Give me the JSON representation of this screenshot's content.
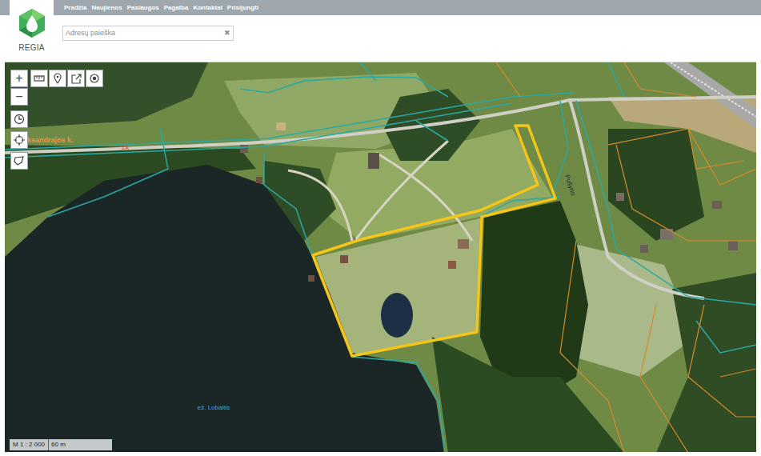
{
  "logo": {
    "label": "REGIA"
  },
  "nav": [
    "Pradžia",
    "Naujienos",
    "Paslaugos",
    "Pagalba",
    "Kontaktai",
    "Prisijungti"
  ],
  "search": {
    "placeholder": "Adresų paieška",
    "clear": "✖"
  },
  "tools": {
    "zoom_in": "+",
    "zoom_out": "−"
  },
  "map": {
    "labels": [
      {
        "text": "Aleksandrajos k."
      },
      {
        "text": "ŽA"
      },
      {
        "text": "Pušyno"
      },
      {
        "text": "ež. Lobaitis"
      }
    ],
    "scale": {
      "ratio": "M 1 : 2 000",
      "distance": "60 m"
    }
  }
}
